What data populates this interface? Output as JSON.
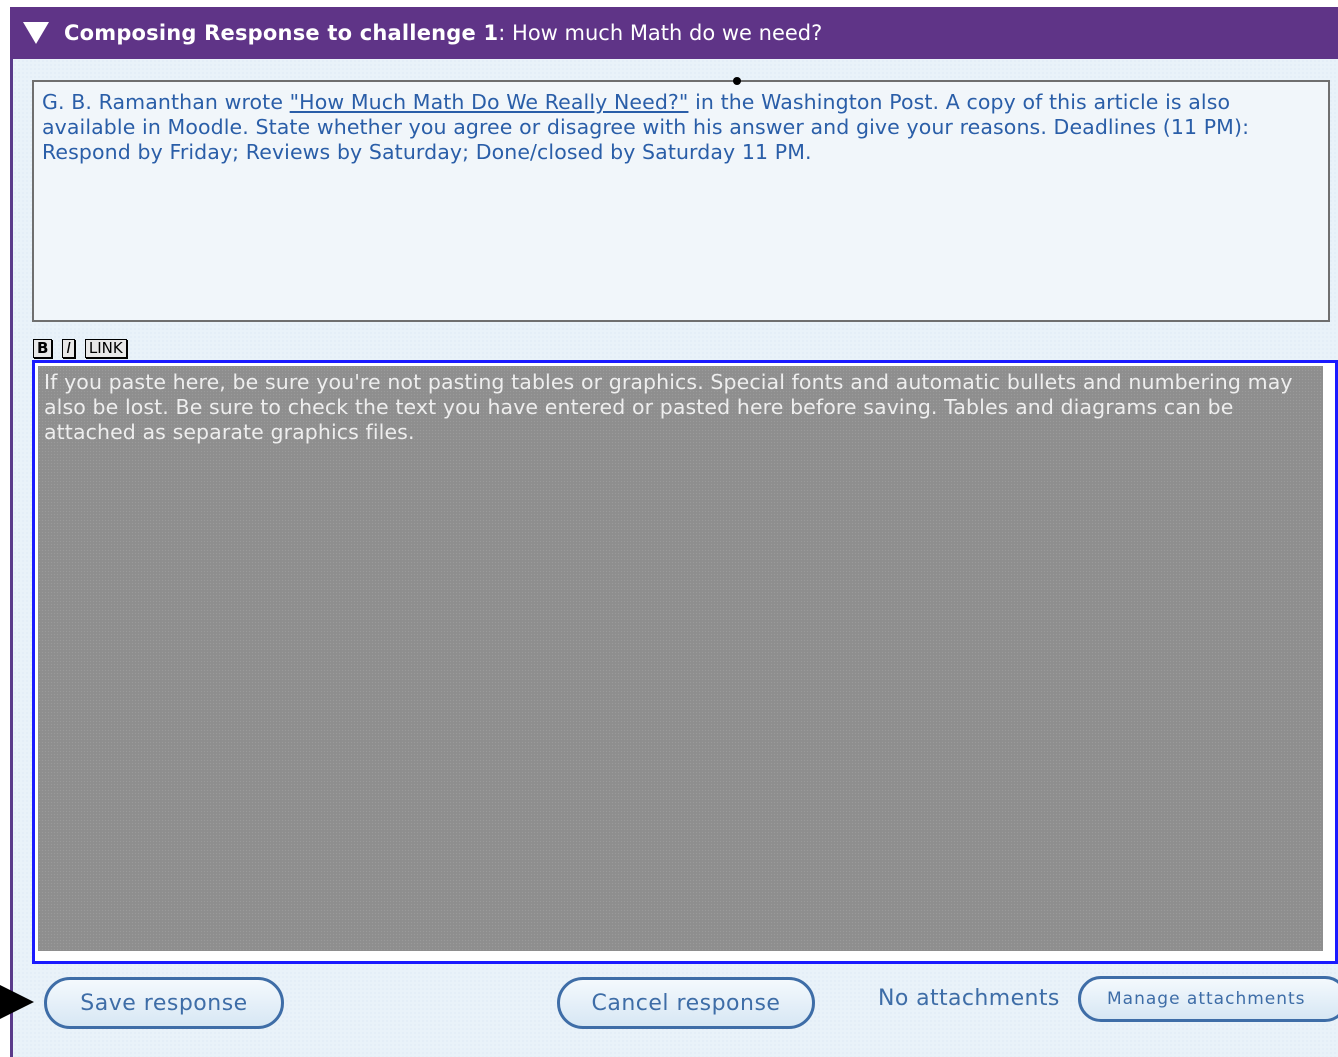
{
  "header": {
    "title_bold": "Composing Response to challenge 1",
    "title_rest": ": How much Math do we need?"
  },
  "prompt": {
    "text_before_link": "G. B. Ramanthan wrote ",
    "link_text": "\"How Much Math Do We Really Need?\"",
    "text_after_link": " in the Washington Post. A copy of this article is also available in Moodle.  State whether you agree or disagree with his answer and give your reasons.  Deadlines (11 PM): Respond by Friday; Reviews by Saturday; Done/closed by Saturday 11 PM."
  },
  "toolbar": {
    "bold_label": "B",
    "italic_label": "I",
    "link_label": "LINK"
  },
  "editor": {
    "placeholder": "If you paste here, be sure you're not pasting tables or graphics. Special fonts and automatic bullets and numbering may also be lost. Be sure to check the text you have entered or pasted here before saving.  Tables and diagrams can be attached as separate graphics files."
  },
  "footer": {
    "save_label": "Save response",
    "cancel_label": "Cancel response",
    "attachments_status": "No attachments",
    "manage_label": "Manage attachments"
  },
  "colors": {
    "header_bg": "#5f3487",
    "link_text": "#2a5ea8",
    "editor_border": "#1a1aff",
    "button_text": "#3e6da7"
  },
  "icons": {
    "collapse": "triangle-down-icon",
    "pointer": "arrow-right-icon"
  }
}
